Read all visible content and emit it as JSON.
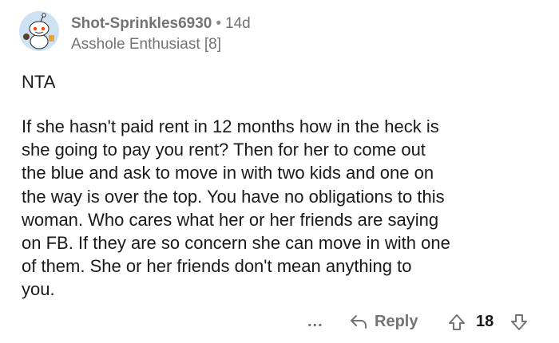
{
  "comment": {
    "author": "Shot-Sprinkles6930",
    "separator": "•",
    "age": "14d",
    "flair": "Asshole Enthusiast [8]",
    "verdict": "NTA",
    "body_lines": [
      "If she hasn't paid rent in 12 months how in the heck is",
      "she going to pay you rent?  Then for her to come out",
      "the blue and ask to move in with two kids and one on",
      "the way is over the top.  You have no obligations to this",
      "woman.  Who cares what her or her friends are saying",
      "on FB.  If they are so concern she can move in with one",
      "of them.  She or her friends don't mean anything to",
      "you."
    ],
    "score": "18"
  },
  "actions": {
    "more_label": "...",
    "reply_label": "Reply"
  },
  "icons": {
    "avatar": "snoo-avatar-icon",
    "reply": "reply-arrow-icon",
    "upvote": "upvote-arrow-icon",
    "downvote": "downvote-arrow-icon"
  },
  "colors": {
    "muted_text": "#737373",
    "body_text": "#1a1a1b",
    "avatar_bg": "#cfe2f3"
  }
}
